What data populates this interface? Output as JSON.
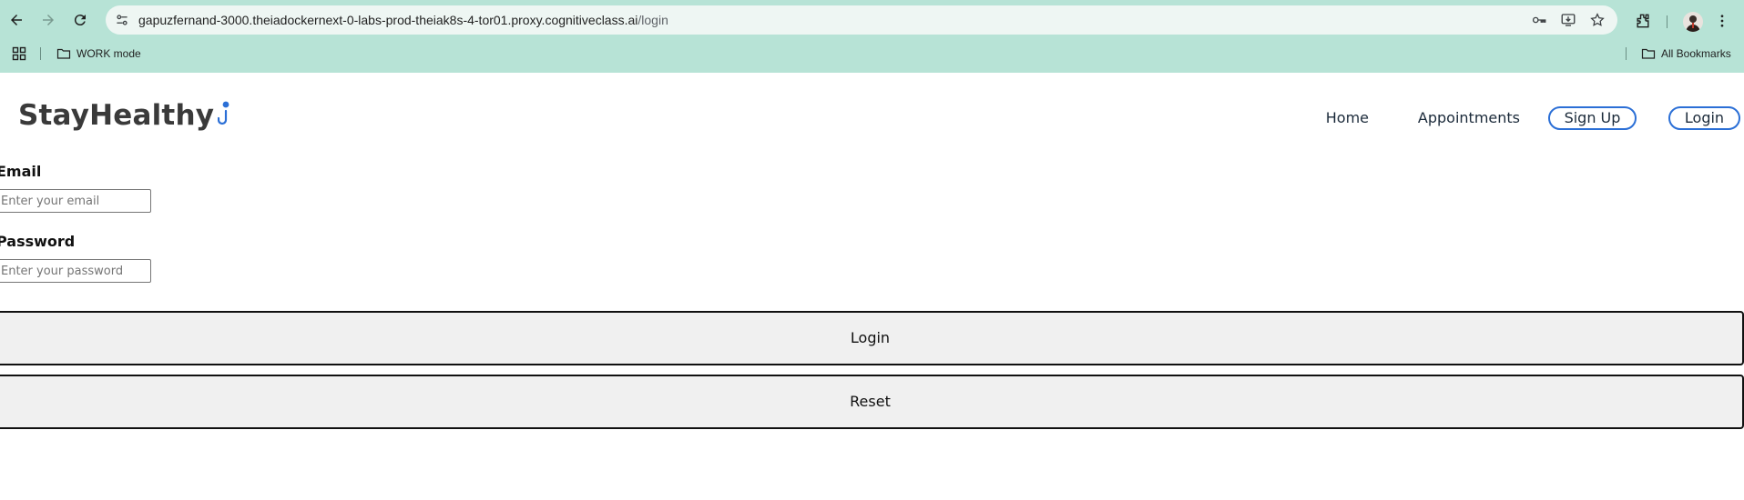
{
  "browser": {
    "url_host": "gapuzfernand-3000.theiadockernext-0-labs-prod-theiak8s-4-tor01.proxy.cognitiveclass.ai",
    "url_path": "/login",
    "bookmarks": [
      {
        "label": "WORK mode"
      },
      {
        "label": "All Bookmarks"
      }
    ]
  },
  "site": {
    "logo_text": "StayHealthy",
    "nav": {
      "home": "Home",
      "appointments": "Appointments",
      "signup": "Sign Up",
      "login": "Login"
    },
    "accent_color": "#2b6fd6"
  },
  "form": {
    "email_label": "Email",
    "email_placeholder": "Enter your email",
    "password_label": "Password",
    "password_placeholder": "Enter your password",
    "login_button": "Login",
    "reset_button": "Reset"
  }
}
